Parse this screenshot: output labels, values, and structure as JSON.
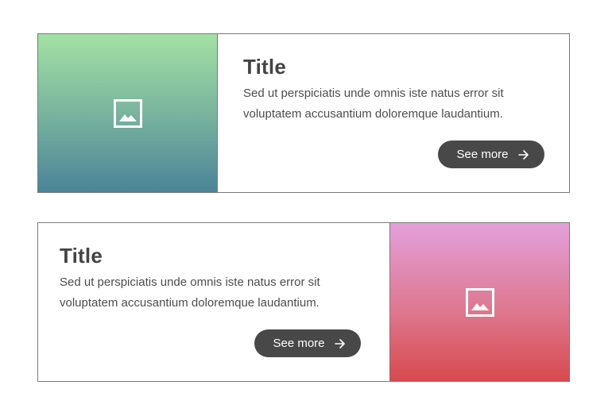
{
  "cards": [
    {
      "image_icon": "image-icon",
      "title": "Title",
      "description": "Sed ut perspiciatis unde omnis iste natus error sit voluptatem accusantium doloremque laudantium.",
      "button_label": "See more",
      "button_icon": "arrow-right-icon",
      "image_gradient": [
        "#a3e1a3",
        "#4b8498"
      ]
    },
    {
      "image_icon": "image-icon",
      "title": "Title",
      "description": "Sed ut perspiciatis unde omnis iste natus error sit voluptatem accusantium doloremque laudantium.",
      "button_label": "See more",
      "button_icon": "arrow-right-icon",
      "image_gradient": [
        "#e4a0db",
        "#d74a4e"
      ]
    }
  ],
  "colors": {
    "border": "#7a7a7a",
    "title": "#444444",
    "text": "#4d4d4d",
    "button_bg": "#484848",
    "button_text": "#ffffff"
  }
}
